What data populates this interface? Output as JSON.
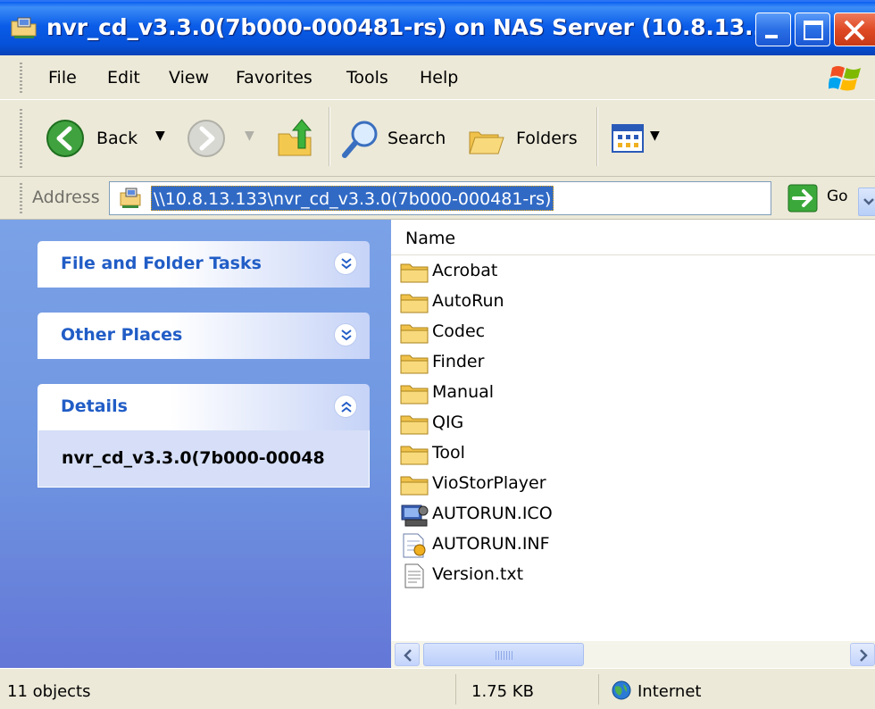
{
  "window": {
    "title": "nvr_cd_v3.3.0(7b000-000481-rs) on NAS Server (10.8.13....",
    "buttons": [
      "minimize",
      "maximize",
      "close"
    ]
  },
  "menu": {
    "items": [
      "File",
      "Edit",
      "View",
      "Favorites",
      "Tools",
      "Help"
    ]
  },
  "toolbar": {
    "back_label": "Back",
    "search_label": "Search",
    "folders_label": "Folders"
  },
  "address": {
    "label": "Address",
    "value": "\\\\10.8.13.133\\nvr_cd_v3.3.0(7b000-000481-rs)",
    "go_label": "Go"
  },
  "taskpane": {
    "sections": [
      {
        "title": "File and Folder Tasks",
        "state": "collapsed"
      },
      {
        "title": "Other Places",
        "state": "collapsed"
      },
      {
        "title": "Details",
        "state": "expanded",
        "content": "nvr_cd_v3.3.0(7b000-00048"
      }
    ]
  },
  "filelist": {
    "column_header": "Name",
    "items": [
      {
        "name": "Acrobat",
        "icon": "folder-icon"
      },
      {
        "name": "AutoRun",
        "icon": "folder-icon"
      },
      {
        "name": "Codec",
        "icon": "folder-icon"
      },
      {
        "name": "Finder",
        "icon": "folder-icon"
      },
      {
        "name": "Manual",
        "icon": "folder-icon"
      },
      {
        "name": "QIG",
        "icon": "folder-icon"
      },
      {
        "name": "Tool",
        "icon": "folder-icon"
      },
      {
        "name": "VioStorPlayer",
        "icon": "folder-icon"
      },
      {
        "name": "AUTORUN.ICO",
        "icon": "ico-file-icon"
      },
      {
        "name": "AUTORUN.INF",
        "icon": "inf-file-icon"
      },
      {
        "name": "Version.txt",
        "icon": "text-file-icon"
      }
    ]
  },
  "statusbar": {
    "objects": "11 objects",
    "size": "1.75 KB",
    "zone": "Internet"
  },
  "colors": {
    "titlebar": "#0a5ce8",
    "taskpane": "#6f96e1",
    "task_title": "#215dc6",
    "selection": "#316ac5",
    "chrome": "#ece9d8"
  }
}
